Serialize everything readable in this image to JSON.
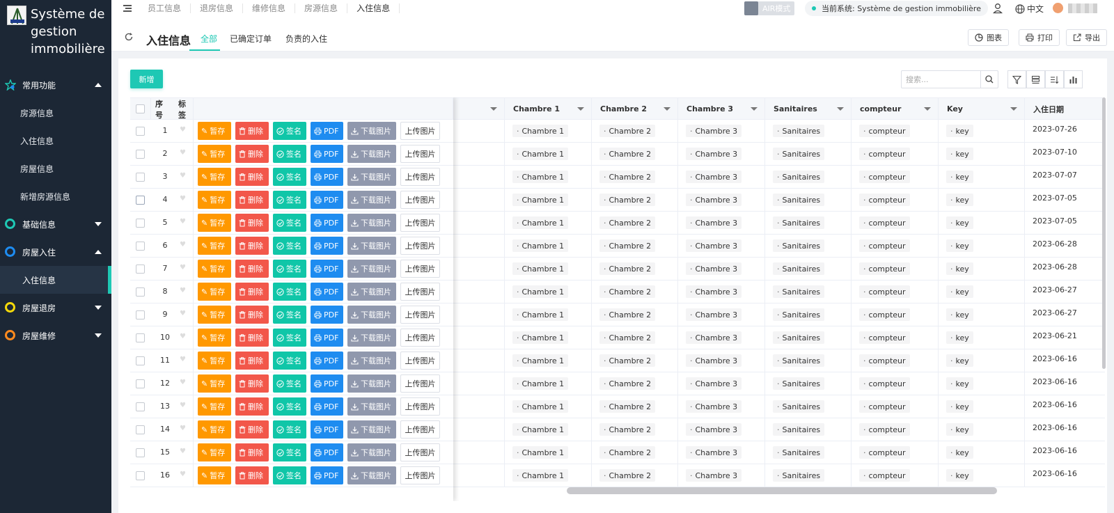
{
  "app": {
    "title": "Système de gestion immobilière"
  },
  "sidebar": {
    "groups": [
      {
        "label": "常用功能",
        "icon": "star-icon",
        "color": "#1ec8b4",
        "expanded": true,
        "items": [
          {
            "label": "房源信息"
          },
          {
            "label": "入住信息"
          },
          {
            "label": "房屋信息"
          },
          {
            "label": "新增房源信息"
          }
        ]
      },
      {
        "label": "基础信息",
        "icon": "circle-icon",
        "color": "#1ec8b4",
        "expanded": false
      },
      {
        "label": "房屋入住",
        "icon": "circle-icon",
        "color": "#1e8cf0",
        "expanded": true,
        "items": [
          {
            "label": "入住信息"
          }
        ]
      },
      {
        "label": "房屋退房",
        "icon": "circle-icon",
        "color": "#f5d90a",
        "expanded": false
      },
      {
        "label": "房屋维修",
        "icon": "circle-icon",
        "color": "#ff8a1e",
        "expanded": false
      }
    ]
  },
  "topnav": {
    "items": [
      "员工信息",
      "退房信息",
      "维修信息",
      "房源信息",
      "入住信息"
    ],
    "current_index": 4
  },
  "topbar": {
    "air_mode": "AIR模式",
    "current_system": "当前系统: Système de gestion immobilière",
    "lang": "中文"
  },
  "page": {
    "title": "入住信息",
    "tabs": [
      "全部",
      "已确定订单",
      "负责的入住"
    ],
    "selected_tab": 0,
    "actions": {
      "chart": "图表",
      "print": "打印",
      "export": "导出"
    }
  },
  "toolbar": {
    "new_label": "新增",
    "search_placeholder": "搜索..."
  },
  "table": {
    "columns": {
      "index": "序号",
      "tag": "标签",
      "chambre1": "Chambre 1",
      "chambre2": "Chambre 2",
      "chambre3": "Chambre 3",
      "sanitaires": "Sanitaires",
      "compteur": "compteur",
      "key": "Key",
      "date": "入住日期"
    },
    "row_actions": {
      "save": "暂存",
      "delete": "删除",
      "sign": "签名",
      "pdf": "PDF",
      "download": "下载图片",
      "upload": "上传图片"
    },
    "rows": [
      {
        "idx": "1",
        "chambre1": "Chambre 1",
        "chambre2": "Chambre 2",
        "chambre3": "Chambre 3",
        "sanitaires": "Sanitaires",
        "compteur": "compteur",
        "key": "key",
        "date": "2023-07-26"
      },
      {
        "idx": "2",
        "chambre1": "Chambre 1",
        "chambre2": "Chambre 2",
        "chambre3": "Chambre 3",
        "sanitaires": "Sanitaires",
        "compteur": "compteur",
        "key": "key",
        "date": "2023-07-10"
      },
      {
        "idx": "3",
        "chambre1": "Chambre 1",
        "chambre2": "Chambre 2",
        "chambre3": "Chambre 3",
        "sanitaires": "Sanitaires",
        "compteur": "compteur",
        "key": "key",
        "date": "2023-07-07"
      },
      {
        "idx": "4",
        "chambre1": "Chambre 1",
        "chambre2": "Chambre 2",
        "chambre3": "Chambre 3",
        "sanitaires": "Sanitaires",
        "compteur": "compteur",
        "key": "key",
        "date": "2023-07-05"
      },
      {
        "idx": "5",
        "chambre1": "Chambre 1",
        "chambre2": "Chambre 2",
        "chambre3": "Chambre 3",
        "sanitaires": "Sanitaires",
        "compteur": "compteur",
        "key": "key",
        "date": "2023-07-05"
      },
      {
        "idx": "6",
        "chambre1": "Chambre 1",
        "chambre2": "Chambre 2",
        "chambre3": "Chambre 3",
        "sanitaires": "Sanitaires",
        "compteur": "compteur",
        "key": "key",
        "date": "2023-06-28"
      },
      {
        "idx": "7",
        "chambre1": "Chambre 1",
        "chambre2": "Chambre 2",
        "chambre3": "Chambre 3",
        "sanitaires": "Sanitaires",
        "compteur": "compteur",
        "key": "key",
        "date": "2023-06-28"
      },
      {
        "idx": "8",
        "chambre1": "Chambre 1",
        "chambre2": "Chambre 2",
        "chambre3": "Chambre 3",
        "sanitaires": "Sanitaires",
        "compteur": "compteur",
        "key": "key",
        "date": "2023-06-27"
      },
      {
        "idx": "9",
        "chambre1": "Chambre 1",
        "chambre2": "Chambre 2",
        "chambre3": "Chambre 3",
        "sanitaires": "Sanitaires",
        "compteur": "compteur",
        "key": "key",
        "date": "2023-06-27"
      },
      {
        "idx": "10",
        "chambre1": "Chambre 1",
        "chambre2": "Chambre 2",
        "chambre3": "Chambre 3",
        "sanitaires": "Sanitaires",
        "compteur": "compteur",
        "key": "key",
        "date": "2023-06-21"
      },
      {
        "idx": "11",
        "chambre1": "Chambre 1",
        "chambre2": "Chambre 2",
        "chambre3": "Chambre 3",
        "sanitaires": "Sanitaires",
        "compteur": "compteur",
        "key": "key",
        "date": "2023-06-16"
      },
      {
        "idx": "12",
        "chambre1": "Chambre 1",
        "chambre2": "Chambre 2",
        "chambre3": "Chambre 3",
        "sanitaires": "Sanitaires",
        "compteur": "compteur",
        "key": "key",
        "date": "2023-06-16"
      },
      {
        "idx": "13",
        "chambre1": "Chambre 1",
        "chambre2": "Chambre 2",
        "chambre3": "Chambre 3",
        "sanitaires": "Sanitaires",
        "compteur": "compteur",
        "key": "key",
        "date": "2023-06-16"
      },
      {
        "idx": "14",
        "chambre1": "Chambre 1",
        "chambre2": "Chambre 2",
        "chambre3": "Chambre 3",
        "sanitaires": "Sanitaires",
        "compteur": "compteur",
        "key": "key",
        "date": "2023-06-16"
      },
      {
        "idx": "15",
        "chambre1": "Chambre 1",
        "chambre2": "Chambre 2",
        "chambre3": "Chambre 3",
        "sanitaires": "Sanitaires",
        "compteur": "compteur",
        "key": "key",
        "date": "2023-06-16"
      },
      {
        "idx": "16",
        "chambre1": "Chambre 1",
        "chambre2": "Chambre 2",
        "chambre3": "Chambre 3",
        "sanitaires": "Sanitaires",
        "compteur": "compteur",
        "key": "key",
        "date": "2023-06-16"
      }
    ]
  },
  "colors": {
    "accent": "#1ec8b4",
    "sidebar_bg": "#1c2735",
    "save": "#ff9800",
    "delete": "#f2574a",
    "sign": "#10c6a8",
    "pdf": "#1e8cf0",
    "download": "#9098ad"
  }
}
